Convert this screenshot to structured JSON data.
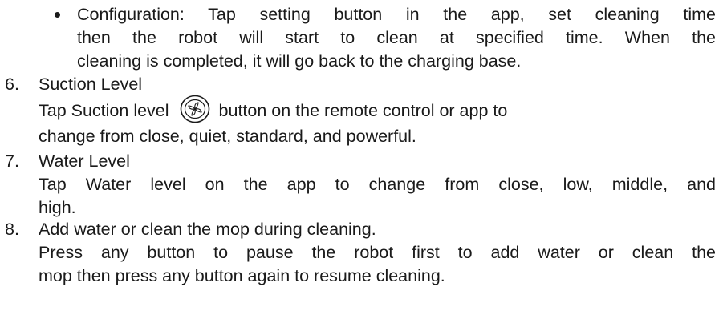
{
  "bullet": {
    "lines": [
      "Configuration: Tap setting button in the app, set cleaning time",
      "then the robot will start to clean at specified time. When the",
      "cleaning is completed, it will go back to the charging base."
    ]
  },
  "sections": [
    {
      "number": "6.",
      "title": "Suction Level",
      "line1_before": "Tap Suction level",
      "icon": "suction-fan-icon",
      "line1_after": "button on the remote control or app to",
      "line2": "change from close, quiet, standard, and powerful."
    },
    {
      "number": "7.",
      "title": "Water Level",
      "line1": "Tap Water level on the app to change from close, low, middle, and",
      "line2": "high."
    },
    {
      "number": "8.",
      "title": "Add water or clean the mop during cleaning.",
      "line1": "Press any button to pause the robot first to add water or clean the",
      "line2": "mop then press any button again to resume cleaning."
    }
  ]
}
